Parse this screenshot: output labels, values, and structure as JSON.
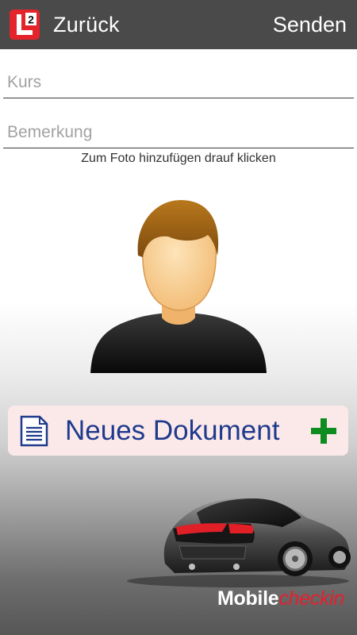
{
  "header": {
    "logo_icon": "l2-logo-icon",
    "logo_text": "2",
    "back_label": "Zurück",
    "send_label": "Senden"
  },
  "form": {
    "kurs_placeholder": "Kurs",
    "kurs_value": "",
    "bemerkung_placeholder": "Bemerkung",
    "bemerkung_value": ""
  },
  "photo": {
    "hint": "Zum Foto hinzufügen drauf klicken",
    "icon": "user-avatar-icon"
  },
  "document_button": {
    "label": "Neues Dokument",
    "icon": "document-icon",
    "add_icon": "plus-icon"
  },
  "branding": {
    "part1": "Mobile",
    "part2": "checkin",
    "image": "car-icon"
  },
  "colors": {
    "header_bg": "#4a4a4a",
    "button_bg": "#fbe9ea",
    "button_text": "#1f3a8c",
    "plus": "#0f8c1f",
    "brand_red": "#e5202e"
  }
}
